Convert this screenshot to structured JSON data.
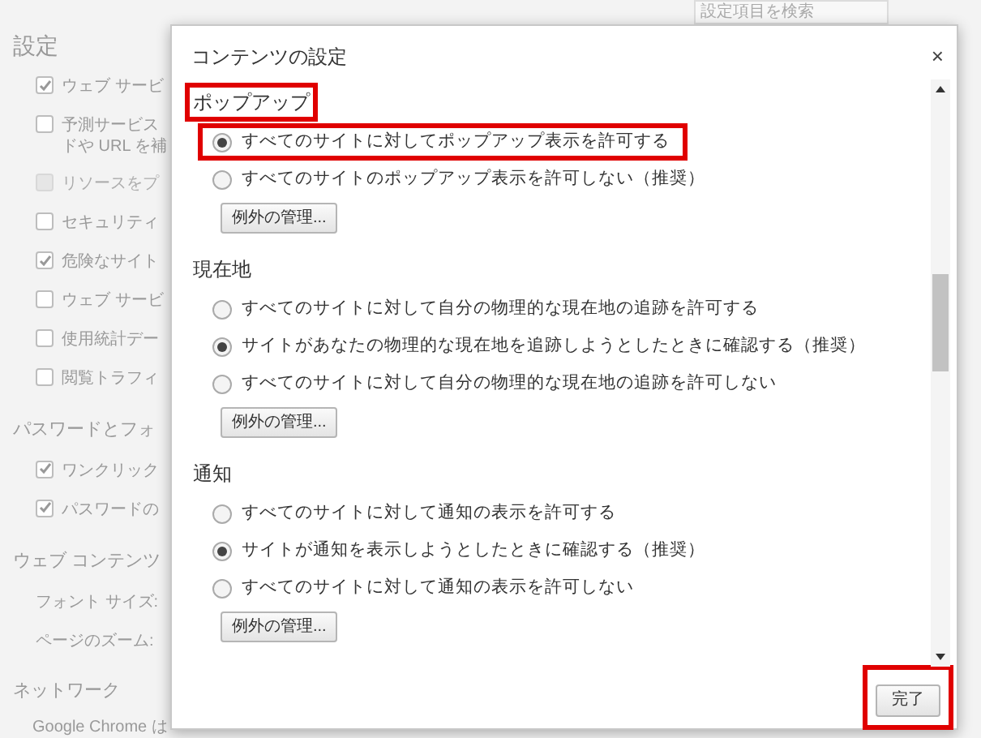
{
  "background": {
    "title": "設定",
    "search": {
      "placeholder": "設定項目を検索"
    },
    "sections": [
      {
        "items": [
          {
            "kind": "checkbox",
            "label": "ウェブ サービ",
            "checked": true,
            "disabled": false
          },
          {
            "kind": "checkbox",
            "label": "予測サービス",
            "label_2": "ドや URL を補",
            "checked": false,
            "disabled": false
          },
          {
            "kind": "checkbox",
            "label": "リソースをプ",
            "checked": false,
            "disabled": true
          },
          {
            "kind": "checkbox",
            "label": "セキュリティ",
            "checked": false,
            "disabled": false
          },
          {
            "kind": "checkbox",
            "label": "危険なサイト",
            "checked": true,
            "disabled": false
          },
          {
            "kind": "checkbox",
            "label": "ウェブ サービ",
            "checked": false,
            "disabled": false
          },
          {
            "kind": "checkbox",
            "label": "使用統計デー",
            "checked": false,
            "disabled": false
          },
          {
            "kind": "checkbox",
            "label": "閲覧トラフィ",
            "checked": false,
            "disabled": false
          }
        ]
      },
      {
        "heading": "パスワードとフォ",
        "items": [
          {
            "kind": "checkbox",
            "label": "ワンクリック",
            "checked": true,
            "disabled": false
          },
          {
            "kind": "checkbox",
            "label": "パスワードの",
            "checked": true,
            "disabled": false
          }
        ]
      },
      {
        "heading": "ウェブ コンテンツ",
        "items": [
          {
            "kind": "field",
            "label": "フォント サイズ:"
          },
          {
            "kind": "field",
            "label": "ページのズーム:"
          }
        ]
      },
      {
        "heading": "ネットワーク",
        "items": [
          {
            "kind": "text",
            "label": "Google Chrome は"
          }
        ]
      }
    ]
  },
  "dialog": {
    "title": "コンテンツの設定",
    "close": "×",
    "sections": [
      {
        "heading": "ポップアップ",
        "highlighted": true,
        "options": [
          {
            "label": "すべてのサイトに対してポップアップ表示を許可する",
            "selected": true,
            "highlighted": true
          },
          {
            "label": "すべてのサイトのポップアップ表示を許可しない（推奨）",
            "selected": false,
            "highlighted": false
          }
        ],
        "button": "例外の管理..."
      },
      {
        "heading": "現在地",
        "highlighted": false,
        "options": [
          {
            "label": "すべてのサイトに対して自分の物理的な現在地の追跡を許可する",
            "selected": false,
            "highlighted": false
          },
          {
            "label": "サイトがあなたの物理的な現在地を追跡しようとしたときに確認する（推奨）",
            "selected": true,
            "highlighted": false
          },
          {
            "label": "すべてのサイトに対して自分の物理的な現在地の追跡を許可しない",
            "selected": false,
            "highlighted": false
          }
        ],
        "button": "例外の管理..."
      },
      {
        "heading": "通知",
        "highlighted": false,
        "options": [
          {
            "label": "すべてのサイトに対して通知の表示を許可する",
            "selected": false,
            "highlighted": false
          },
          {
            "label": "サイトが通知を表示しようとしたときに確認する（推奨）",
            "selected": true,
            "highlighted": false
          },
          {
            "label": "すべてのサイトに対して通知の表示を許可しない",
            "selected": false,
            "highlighted": false
          }
        ],
        "button": "例外の管理..."
      }
    ],
    "done": {
      "label": "完了",
      "highlighted": true
    }
  }
}
